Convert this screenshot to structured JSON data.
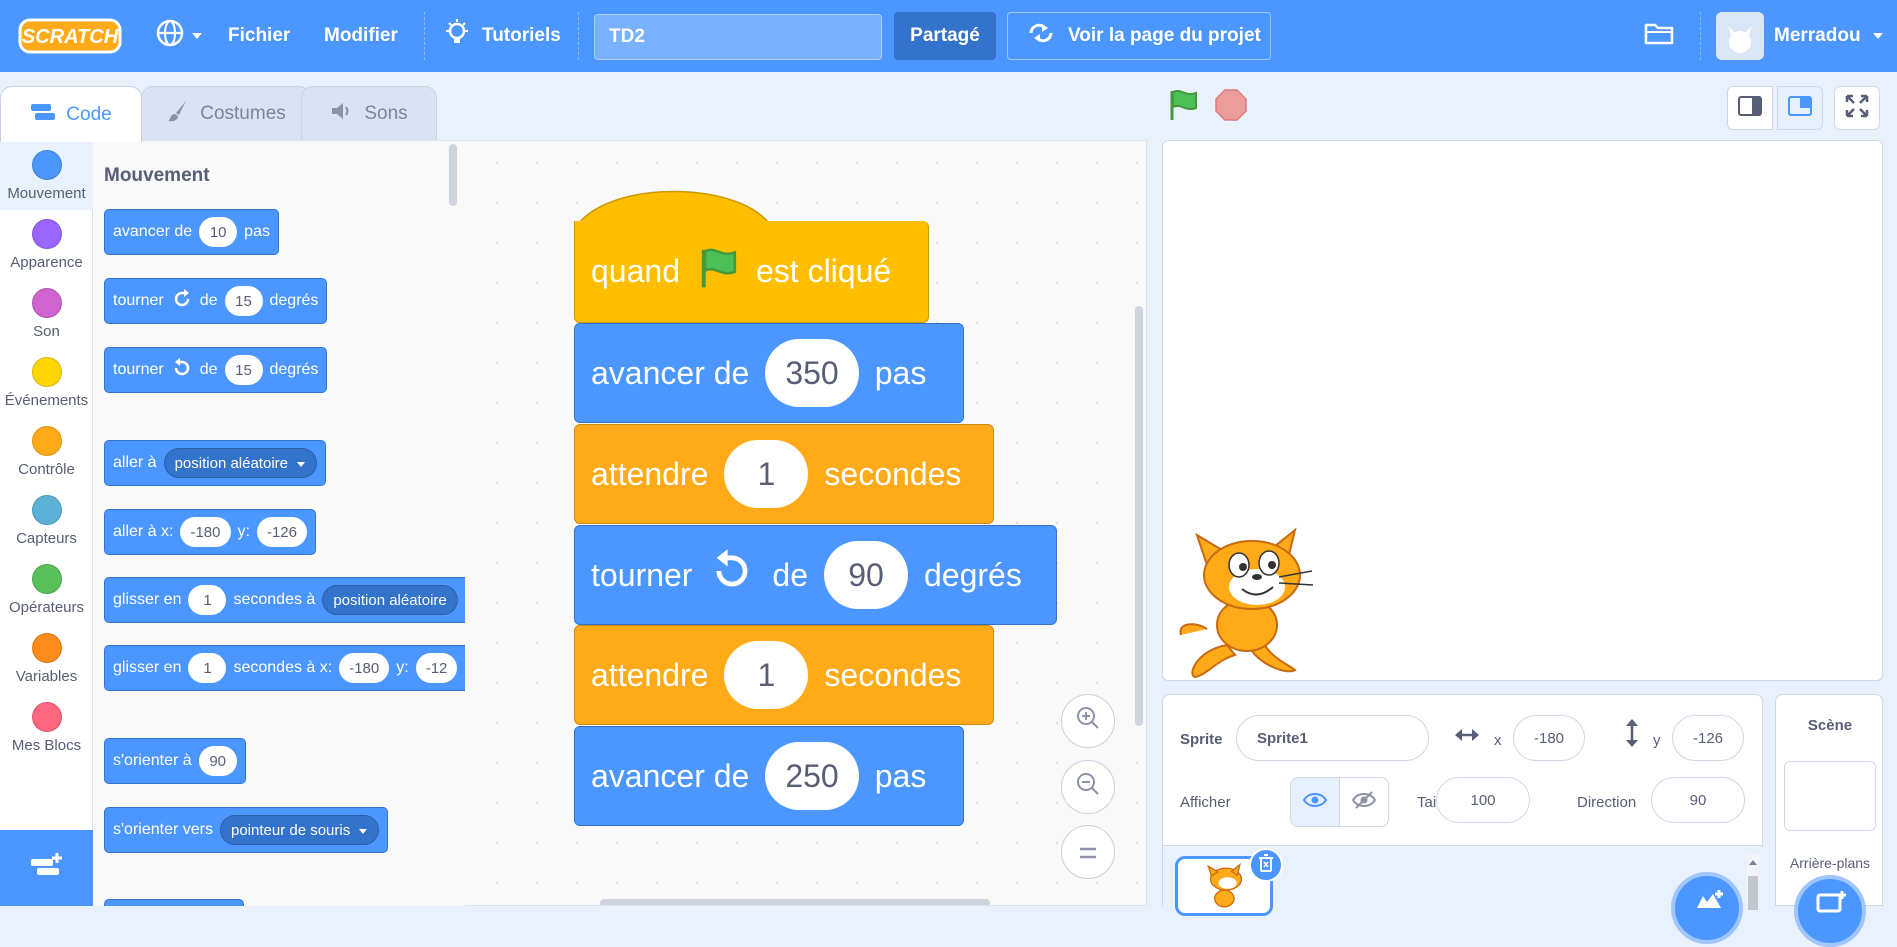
{
  "menu": {
    "file": "Fichier",
    "edit": "Modifier",
    "tutorials": "Tutoriels",
    "project_title": "TD2",
    "shared": "Partagé",
    "see_project_page": "Voir la page du projet",
    "username": "Merradou"
  },
  "tabs": {
    "code": "Code",
    "costumes": "Costumes",
    "sounds": "Sons"
  },
  "categories": [
    {
      "label": "Mouvement",
      "color": "#4c97ff"
    },
    {
      "label": "Apparence",
      "color": "#9966ff"
    },
    {
      "label": "Son",
      "color": "#cf63cf"
    },
    {
      "label": "Événements",
      "color": "#ffd500"
    },
    {
      "label": "Contrôle",
      "color": "#ffab19"
    },
    {
      "label": "Capteurs",
      "color": "#5cb1d6"
    },
    {
      "label": "Opérateurs",
      "color": "#59c059"
    },
    {
      "label": "Variables",
      "color": "#ff8c1a"
    },
    {
      "label": "Mes Blocs",
      "color": "#ff6680"
    }
  ],
  "palette": {
    "heading": "Mouvement",
    "move": {
      "pre": "avancer de",
      "value": "10",
      "post": "pas"
    },
    "turn_right": {
      "pre": "tourner",
      "mid": "de",
      "value": "15",
      "post": "degrés"
    },
    "turn_left": {
      "pre": "tourner",
      "mid": "de",
      "value": "15",
      "post": "degrés"
    },
    "goto": {
      "pre": "aller à",
      "menu": "position aléatoire"
    },
    "goto_xy": {
      "pre": "aller à x:",
      "x": "-180",
      "ylabel": "y:",
      "y": "-126"
    },
    "glide": {
      "pre": "glisser en",
      "value": "1",
      "mid": "secondes à",
      "menu": "position aléatoire"
    },
    "glide_xy": {
      "pre": "glisser en",
      "value": "1",
      "mid": "secondes à x:",
      "x": "-180",
      "ylabel": "y:",
      "y": "-12"
    },
    "point_dir": {
      "pre": "s'orienter à",
      "value": "90"
    },
    "point_towards": {
      "pre": "s'orienter vers",
      "menu": "pointeur de souris"
    }
  },
  "script": {
    "hat": {
      "pre": "quand",
      "post": "est cliqué"
    },
    "b1": {
      "pre": "avancer de",
      "value": "350",
      "post": "pas"
    },
    "b2": {
      "pre": "attendre",
      "value": "1",
      "post": "secondes"
    },
    "b3": {
      "pre": "tourner",
      "mid": "de",
      "value": "90",
      "post": "degrés"
    },
    "b4": {
      "pre": "attendre",
      "value": "1",
      "post": "secondes"
    },
    "b5": {
      "pre": "avancer de",
      "value": "250",
      "post": "pas"
    }
  },
  "sprite_info": {
    "sprite_label": "Sprite",
    "sprite_name": "Sprite1",
    "x_label": "x",
    "x": "-180",
    "y_label": "y",
    "y": "-126",
    "show_label": "Afficher",
    "size_label": "Taille",
    "size": "100",
    "direction_label": "Direction",
    "direction": "90"
  },
  "stage_panel": {
    "title": "Scène",
    "backdrops": "Arrière-plans"
  },
  "colors": {
    "menu_bg": "#4c97ff",
    "motion": "#4c97ff",
    "control": "#ffab19",
    "events": "#ffbf00"
  }
}
